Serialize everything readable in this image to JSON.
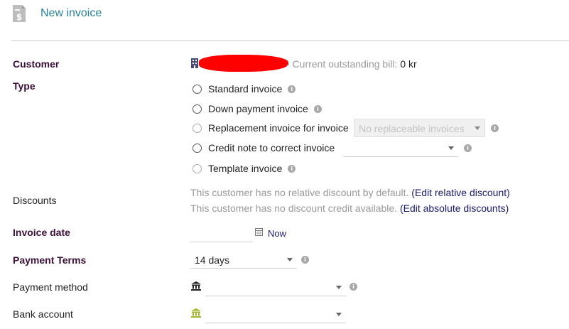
{
  "header": {
    "title": "New invoice",
    "icon": "invoice-dollar-icon"
  },
  "customer": {
    "label": "Customer",
    "outstanding_label": "- Current outstanding bill:",
    "outstanding_value": "0 kr"
  },
  "type": {
    "label": "Type",
    "options": [
      {
        "label": "Standard invoice"
      },
      {
        "label": "Down payment invoice"
      },
      {
        "label": "Replacement invoice for invoice",
        "select_value": "No replaceable invoices"
      },
      {
        "label": "Credit note to correct invoice"
      },
      {
        "label": "Template invoice"
      }
    ]
  },
  "discounts": {
    "label": "Discounts",
    "relative_text": "This customer has no relative discount by default.",
    "relative_link": "(Edit relative discount)",
    "absolute_text": "This customer has no discount credit available.",
    "absolute_link": "(Edit absolute discounts)"
  },
  "invoice_date": {
    "label": "Invoice date",
    "value": "",
    "now_label": "Now"
  },
  "payment_terms": {
    "label": "Payment Terms",
    "value": "14 days"
  },
  "payment_method": {
    "label": "Payment method",
    "value": ""
  },
  "bank_account": {
    "label": "Bank account",
    "value": ""
  },
  "colors": {
    "accent": "#26819a",
    "label_bold": "#3b0f38",
    "redaction": "#ff0000"
  }
}
